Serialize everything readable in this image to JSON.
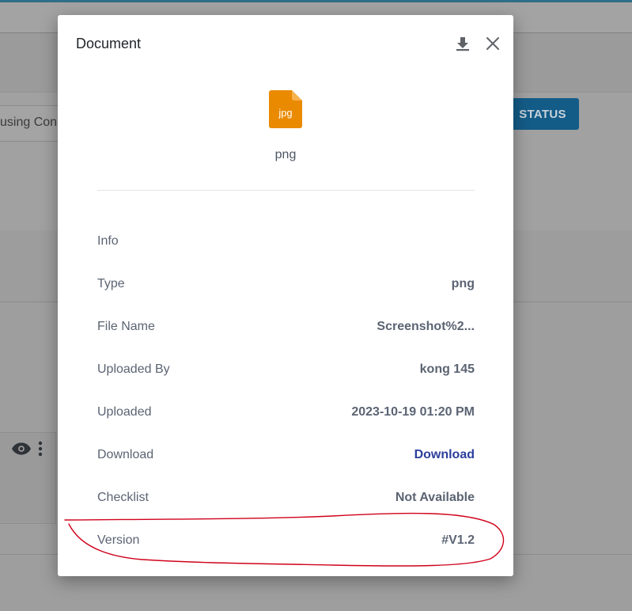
{
  "background": {
    "search_text": "using Con",
    "status_button": "STATUS"
  },
  "modal": {
    "title": "Document",
    "icons": {
      "download": "download-icon",
      "close": "close-icon"
    },
    "file": {
      "badge": "jpg",
      "badge_color": "#ea8a00",
      "caption": "png"
    },
    "rows": [
      {
        "label": "Info",
        "value": ""
      },
      {
        "label": "Type",
        "value": "png"
      },
      {
        "label": "File Name",
        "value": "Screenshot%2..."
      },
      {
        "label": "Uploaded By",
        "value": "kong 145"
      },
      {
        "label": "Uploaded",
        "value": "2023-10-19 01:20 PM"
      },
      {
        "label": "Download",
        "value": "Download"
      },
      {
        "label": "Checklist",
        "value": "Not Available"
      },
      {
        "label": "Version",
        "value": "#V1.2"
      }
    ]
  },
  "colors": {
    "link": "#2c3e9c",
    "annotation": "#d0021b",
    "status_button": "#145c88"
  }
}
